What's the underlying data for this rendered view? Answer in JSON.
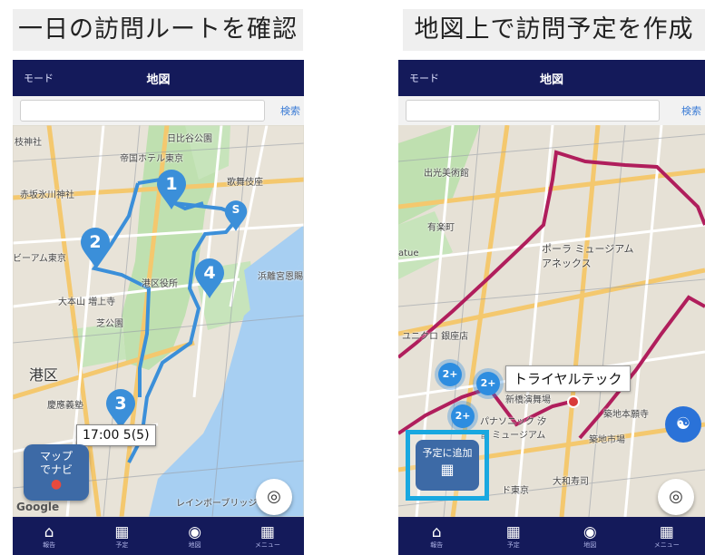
{
  "captions": {
    "left": "一日の訪問ルートを確認",
    "right": "地図上で訪問予定を作成"
  },
  "screen_left": {
    "nav": {
      "mode": "モード",
      "title": "地図"
    },
    "search": {
      "placeholder": "",
      "button": "検索"
    },
    "map_labels": {
      "l1": "日比谷公園",
      "l2": "帝国ホテル東京",
      "l3": "赤坂氷川神社",
      "l4": "歌舞伎座",
      "l5": "港区役所",
      "l6": "大本山 増上寺",
      "l7": "芝公園",
      "l8": "浜離宮恩賜",
      "l9": "港区",
      "l10": "慶應義塾",
      "l11": "レインボーブリッジ",
      "l12": "枝神社",
      "l13": "ビーアム東京"
    },
    "pins": [
      "1",
      "2",
      "3",
      "4",
      "S"
    ],
    "tooltip": "17:00 5(5)",
    "navi_button": {
      "line1": "マップ",
      "line2": "でナビ"
    },
    "google": "Google",
    "tabs": [
      "報告",
      "予定",
      "地図",
      "メニュー"
    ]
  },
  "screen_right": {
    "nav": {
      "mode": "モード",
      "title": "地図"
    },
    "search": {
      "placeholder": "",
      "button": "検索"
    },
    "map_labels": {
      "r1": "出光美術館",
      "r2": "ポーラ ミュージアム アネックス",
      "r3": "ユニクロ 銀座店",
      "r4": "新橋演舞場",
      "r5": "パナソニック 汐留 ミュージアム",
      "r6": "築地本願寺",
      "r7": "築地市場",
      "r8": "大和寿司",
      "r9": "ド東京",
      "r10": "有楽町",
      "r11": "atue"
    },
    "place_tooltip": "トライヤルテック",
    "clusters": [
      "2+",
      "2+",
      "2+"
    ],
    "add_button": "予定に追加",
    "tabs": [
      "報告",
      "予定",
      "地図",
      "メニュー"
    ]
  },
  "colors": {
    "nav": "#141a5a",
    "route_blue": "#3b8fd9",
    "route_red": "#b01e5c",
    "highlight": "#19a8e0"
  }
}
